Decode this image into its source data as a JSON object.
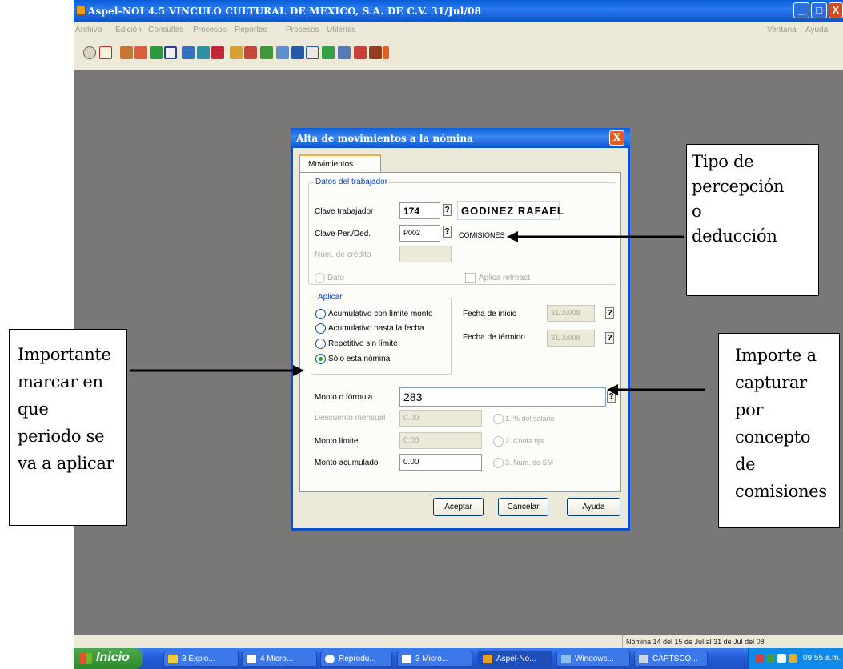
{
  "window": {
    "title": "Aspel-NOI 4.5  VINCULO CULTURAL DE MEXICO, S.A. DE C.V.     31/Jul/08",
    "controls": {
      "minimize": "_",
      "maximize": "□",
      "close": "X"
    }
  },
  "menu": {
    "left": [
      "Archivo",
      "Edición",
      "Consultas",
      "Procesos",
      "Reportes",
      "Procesos",
      "Utilerías"
    ],
    "right": [
      "Ventana",
      "Ayuda"
    ]
  },
  "toolbar_icons": [
    "tool-icon-1",
    "tool-icon-2",
    "tool-icon-3",
    "tool-icon-4",
    "tool-icon-5",
    "tool-icon-6",
    "tool-icon-7",
    "tool-icon-8",
    "tool-icon-9",
    "tool-icon-10",
    "tool-icon-11",
    "tool-icon-12",
    "tool-icon-13",
    "tool-icon-14",
    "tool-icon-15",
    "tool-icon-16",
    "tool-icon-17",
    "tool-icon-18",
    "tool-icon-19",
    "tool-icon-20"
  ],
  "status": {
    "text": "Nómina 14 del 15 de Jul al 31 de Jul del 08"
  },
  "taskbar": {
    "start": "Inicio",
    "tasks": [
      "3 Explo...",
      "4 Micro...",
      "Reprodu...",
      "3 Micro...",
      "Aspel-No...",
      "Windows...",
      "CAPTSCO..."
    ],
    "clock": "09:55 a.m."
  },
  "dialog": {
    "title": "Alta de movimientos a la nómina",
    "close": "X",
    "tab": "Movimientos",
    "worker_group": {
      "legend": "Datos del trabajador",
      "clave_trabajador_label": "Clave trabajador",
      "clave_trabajador_value": "174",
      "worker_name": "GODINEZ RAFAEL",
      "clave_perded_label": "Clave Per./Ded.",
      "clave_perded_value": "P002",
      "concept_name": "COMISIONES",
      "num_credito_label": "Núm. de crédito",
      "dato_label": "Dato",
      "aplica_retroactivo_label": "Aplica retroact"
    },
    "apply_group": {
      "legend": "Aplicar",
      "options": [
        "Acumulativo con límite monto",
        "Acumulativo hasta la fecha",
        "Repetitivo sin límite",
        "Sólo esta nómina"
      ],
      "selected_index": 3
    },
    "fecha_inicio_label": "Fecha de inicio",
    "fecha_inicio_value": "31/Jul/08",
    "fecha_termino_label": "Fecha de término",
    "fecha_termino_value": "31/Jul/08",
    "monto_formula_label": "Monto o fórmula",
    "monto_formula_value": "283",
    "descuento_label": "Descuento mensual",
    "descuento_value": "0.00",
    "monto_limite_label": "Monto límite",
    "monto_limite_value": "0.00",
    "monto_acumulado_label": "Monto acumulado",
    "monto_acumulado_value": "0.00",
    "discount_options": [
      "1. % del salario",
      "2. Cuota fija",
      "3. Num. de SM"
    ],
    "buttons": {
      "accept": "Aceptar",
      "cancel": "Cancelar",
      "help": "Ayuda"
    }
  },
  "annotations": {
    "tipo": [
      "Tipo de",
      "percepción",
      "o",
      "deducción"
    ],
    "importante": [
      "Importante",
      "marcar en",
      "que",
      "periodo se",
      "va a aplicar"
    ],
    "importe": [
      "Importe a",
      "capturar",
      "por",
      "concepto",
      "de",
      "comisiones"
    ]
  }
}
